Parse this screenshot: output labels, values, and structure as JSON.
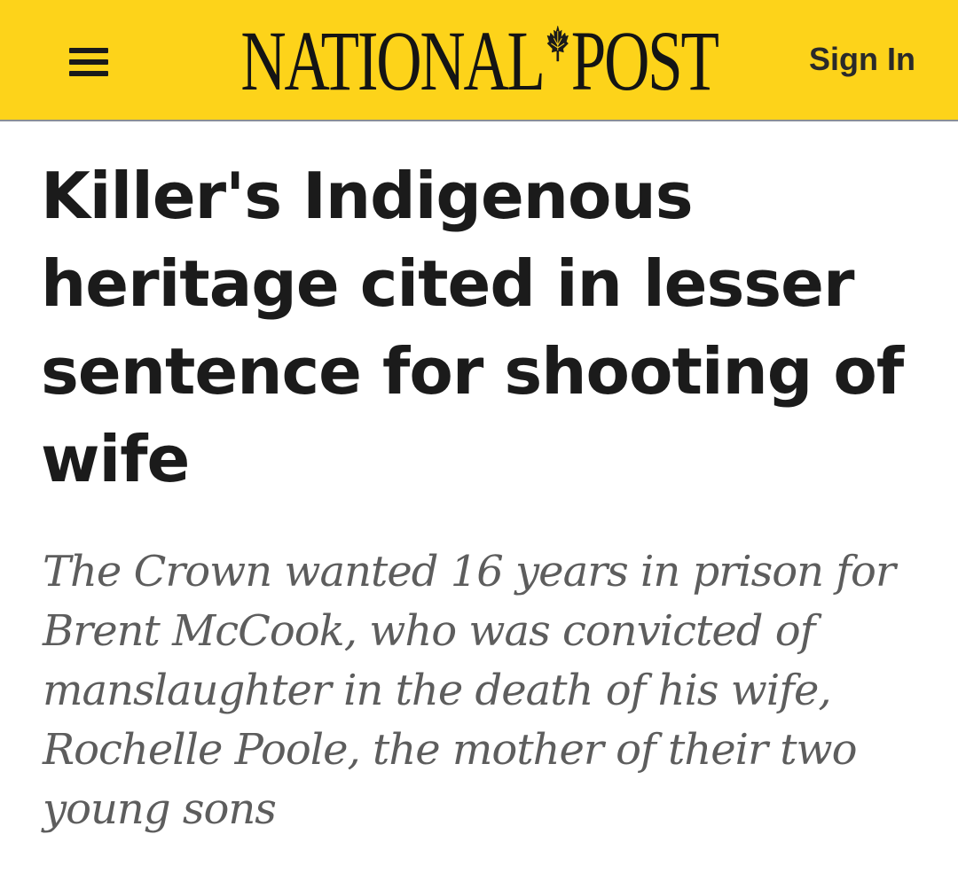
{
  "header": {
    "background_color": "#fdd31a",
    "menu_icon": "hamburger-menu-icon",
    "logo_left": "NATIONAL",
    "logo_right": "POST",
    "logo_emblem": "maple-leaf-icon",
    "sign_in_label": "Sign In"
  },
  "article": {
    "headline": "Killer's Indigenous heritage cited in lesser sentence for shooting of wife",
    "dek": "The Crown wanted 16 years in prison for Brent McCook, who was convicted of manslaughter in the death of his wife, Rochelle Poole, the mother of their two young sons"
  }
}
